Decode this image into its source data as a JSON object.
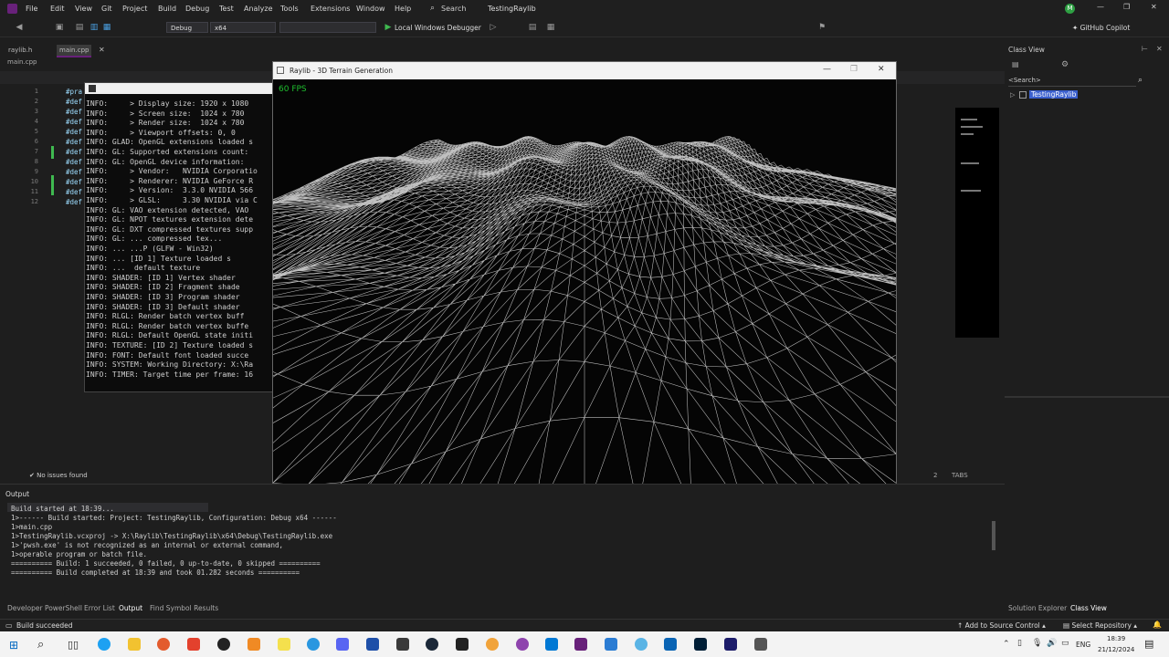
{
  "menu": {
    "items": [
      "File",
      "Edit",
      "View",
      "Git",
      "Project",
      "Build",
      "Debug",
      "Test",
      "Analyze",
      "Tools",
      "Extensions",
      "Window",
      "Help"
    ],
    "search": "Search",
    "solution": "TestingRaylib",
    "avatar_initials": "M"
  },
  "toolbar": {
    "config": "Debug",
    "platform": "x64",
    "debugger": "Local Windows Debugger",
    "copilot": "GitHub Copilot"
  },
  "editor": {
    "tabs": [
      "raylib.h",
      "main.cpp"
    ],
    "file_path": "main.cpp",
    "line_numbers": [
      "1",
      "2",
      "3",
      "4",
      "5",
      "6",
      "7",
      "8",
      "9",
      "10",
      "11",
      "12"
    ],
    "code_lines": [
      "#pra",
      "#def",
      "#def",
      "#def",
      "#def",
      "#def",
      "#def",
      "#def",
      "#def",
      "#def",
      "#def",
      "#def"
    ]
  },
  "console": {
    "lines": [
      "INFO:     > Display size: 1920 x 1080",
      "INFO:     > Screen size:  1024 x 780",
      "INFO:     > Render size:  1024 x 780",
      "INFO:     > Viewport offsets: 0, 0",
      "INFO: GLAD: OpenGL extensions loaded s",
      "INFO: GL: Supported extensions count:",
      "INFO: GL: OpenGL device information:",
      "INFO:     > Vendor:   NVIDIA Corporatio",
      "INFO:     > Renderer: NVIDIA GeForce R",
      "INFO:     > Version:  3.3.0 NVIDIA 566",
      "INFO:     > GLSL:     3.30 NVIDIA via C",
      "INFO: GL: VAO extension detected, VAO",
      "INFO: GL: NPOT textures extension dete",
      "INFO: GL: DXT compressed textures supp",
      "INFO: GL: ... compressed tex...",
      "INFO: ... ...P (GLFW - Win32)",
      "INFO: ... [ID 1] Texture loaded s",
      "INFO: ...  default texture",
      "INFO: SHADER: [ID 1] Vertex shader",
      "INFO: SHADER: [ID 2] Fragment shade",
      "INFO: SHADER: [ID 3] Program shader",
      "INFO: SHADER: [ID 3] Default shader",
      "INFO: RLGL: Render batch vertex buff",
      "INFO: RLGL: Render batch vertex buffe",
      "INFO: RLGL: Default OpenGL state initi",
      "INFO: TEXTURE: [ID 2] Texture loaded s",
      "INFO: FONT: Default font loaded succe",
      "INFO: SYSTEM: Working Directory: X:\\Ra",
      "INFO: TIMER: Target time per frame: 16"
    ]
  },
  "raylib_window": {
    "title": "Raylib - 3D Terrain Generation",
    "fps": "60 FPS"
  },
  "classview": {
    "title": "Class View",
    "search": "<Search>",
    "node": "TestingRaylib"
  },
  "output": {
    "title": "Output",
    "lines": [
      "Build started at 18:39...",
      "1>------ Build started: Project: TestingRaylib, Configuration: Debug x64 ------",
      "1>main.cpp",
      "1>TestingRaylib.vcxproj -> X:\\Raylib\\TestingRaylib\\x64\\Debug\\TestingRaylib.exe",
      "1>'pwsh.exe' is not recognized as an internal or external command,",
      "1>operable program or batch file.",
      "========== Build: 1 succeeded, 0 failed, 0 up-to-date, 0 skipped ==========",
      "========== Build completed at 18:39 and took 01.282 seconds =========="
    ],
    "tabs": [
      "Developer PowerShell",
      "Error List",
      "Output",
      "Find Symbol Results"
    ],
    "right_tabs": [
      "Solution Explorer",
      "Class View"
    ],
    "issues": "No issues found",
    "ln_col": "2",
    "tabs_mode": "TABS"
  },
  "status": {
    "message": "Build succeeded",
    "add_source": "Add to Source Control",
    "select_repo": "Select Repository"
  },
  "taskbar": {
    "lang": "ENG",
    "time": "18:39",
    "date": "21/12/2024"
  },
  "colors": {
    "accent": "#68217a",
    "status_bar": "#202020",
    "terrain": "#ffffff"
  }
}
